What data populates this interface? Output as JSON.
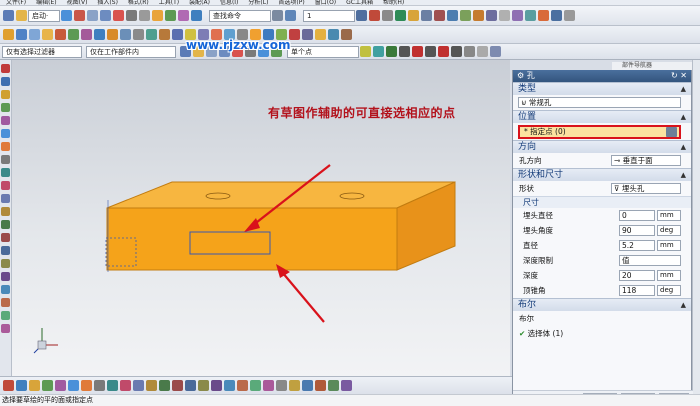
{
  "menubar": {
    "items": [
      "文件(F)",
      "编辑(E)",
      "视图(V)",
      "插入(S)",
      "格式(R)",
      "工具(T)",
      "装配(A)",
      "信息(I)",
      "分析(L)",
      "首选项(P)",
      "窗口(O)",
      "GC工具箱",
      "帮助(H)"
    ]
  },
  "toolbar": {
    "start_label": "启动·",
    "command_search_placeholder": "查找命令",
    "layer_value": "1",
    "selection_filter": "仅有选择过滤器",
    "assembly_scope": "仅在工作部件内",
    "select_mode": "单个点"
  },
  "watermark": "www.rjzxw.com",
  "annotation": "有草图作辅助的可直接选相应的点",
  "dialog": {
    "title": "孔",
    "type_section": "类型",
    "type_value": "常规孔",
    "position_section": "位置",
    "specify_point": "* 指定点 (0)",
    "direction_section": "方向",
    "hole_direction_label": "孔方向",
    "hole_direction_value": "垂直于面",
    "form_section": "形状和尺寸",
    "form_label": "形状",
    "form_value": "埋头孔",
    "size_subsection": "尺寸",
    "fields": [
      {
        "label": "埋头直径",
        "value": "0",
        "unit": "mm"
      },
      {
        "label": "埋头角度",
        "value": "90",
        "unit": "deg"
      },
      {
        "label": "直径",
        "value": "5.2",
        "unit": "mm"
      },
      {
        "label": "深度限制",
        "value": "值",
        "unit": ""
      },
      {
        "label": "深度",
        "value": "20",
        "unit": "mm"
      },
      {
        "label": "顶锥角",
        "value": "118",
        "unit": "deg"
      }
    ],
    "boolean_section": "布尔",
    "boolean_label": "布尔",
    "select_body": "选择体 (1)",
    "ok_button": "确定",
    "apply_button": "应用",
    "cancel_button": "取消"
  },
  "side_tip": "部件导航器",
  "status_text": "选择要草绘的平的面或指定点",
  "colors": {
    "accent": "#1565d8",
    "annotation": "#b3121c",
    "part": "#f5a31a",
    "highlight_box": "#d9121b"
  }
}
